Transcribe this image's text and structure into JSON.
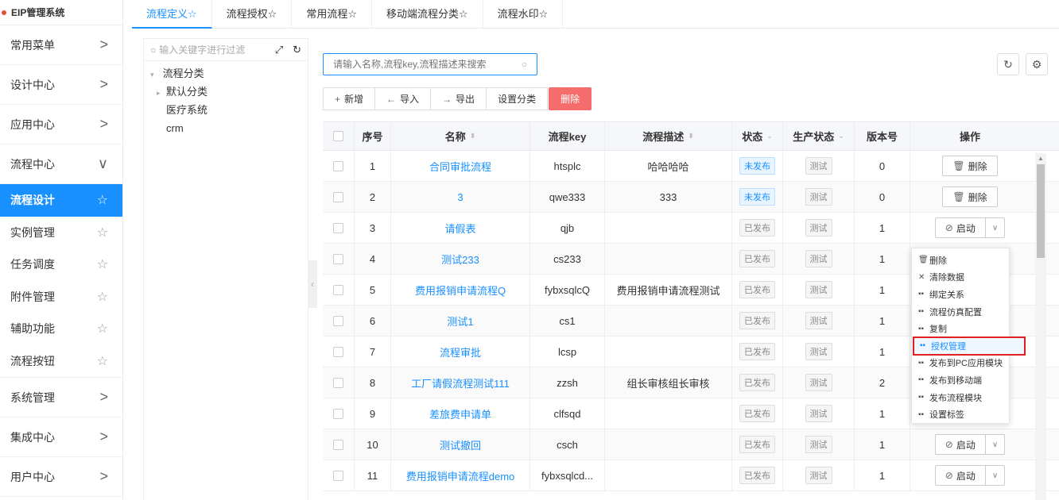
{
  "brand": "EIP管理系统",
  "sidebar": {
    "groups_top": [
      {
        "label": "常用菜单",
        "chev": ">"
      },
      {
        "label": "设计中心",
        "chev": ">"
      },
      {
        "label": "应用中心",
        "chev": ">"
      },
      {
        "label": "流程中心",
        "chev": "∨"
      }
    ],
    "sub_items": [
      {
        "label": "流程设计",
        "active": true
      },
      {
        "label": "实例管理"
      },
      {
        "label": "任务调度"
      },
      {
        "label": "附件管理"
      },
      {
        "label": "辅助功能"
      },
      {
        "label": "流程按钮"
      }
    ],
    "groups_bottom": [
      {
        "label": "系统管理",
        "chev": ">"
      },
      {
        "label": "集成中心",
        "chev": ">"
      },
      {
        "label": "用户中心",
        "chev": ">"
      }
    ]
  },
  "tabs": [
    {
      "label": "流程定义☆",
      "active": true
    },
    {
      "label": "流程授权☆"
    },
    {
      "label": "常用流程☆"
    },
    {
      "label": "移动端流程分类☆"
    },
    {
      "label": "流程水印☆"
    }
  ],
  "tree": {
    "search_placeholder": "输入关键字进行过滤",
    "root": "流程分类",
    "children": [
      {
        "label": "默认分类",
        "arrow": "▸"
      },
      {
        "label": "医疗系统"
      },
      {
        "label": "crm"
      }
    ]
  },
  "search": {
    "placeholder": "请输入名称,流程key,流程描述来搜索"
  },
  "toolbar": {
    "add": "新增",
    "import": "导入",
    "export": "导出",
    "set_category": "设置分类",
    "delete": "删除"
  },
  "table": {
    "headers": {
      "no": "序号",
      "name": "名称",
      "key": "流程key",
      "desc": "流程描述",
      "status": "状态",
      "prod": "生产状态",
      "ver": "版本号",
      "op": "操作"
    },
    "rows": [
      {
        "no": "1",
        "name": "合同审批流程",
        "key": "htsplc",
        "desc": "哈哈哈哈",
        "status": "未发布",
        "status_type": "blue",
        "prod": "测试",
        "ver": "0",
        "op": "删除",
        "op_type": "delete"
      },
      {
        "no": "2",
        "name": "3",
        "key": "qwe333",
        "desc": "333",
        "status": "未发布",
        "status_type": "blue",
        "prod": "测试",
        "ver": "0",
        "op": "删除",
        "op_type": "delete"
      },
      {
        "no": "3",
        "name": "请假表",
        "key": "qjb",
        "desc": "",
        "status": "已发布",
        "status_type": "gray",
        "prod": "测试",
        "ver": "1",
        "op": "启动",
        "op_type": "start"
      },
      {
        "no": "4",
        "name": "测试233",
        "key": "cs233",
        "desc": "",
        "status": "已发布",
        "status_type": "gray",
        "prod": "测试",
        "ver": "1",
        "op": "",
        "op_type": "none"
      },
      {
        "no": "5",
        "name": "费用报销申请流程Q",
        "key": "fybxsqlcQ",
        "desc": "费用报销申请流程测试",
        "status": "已发布",
        "status_type": "gray",
        "prod": "测试",
        "ver": "1",
        "op": "",
        "op_type": "none"
      },
      {
        "no": "6",
        "name": "测试1",
        "key": "cs1",
        "desc": "",
        "status": "已发布",
        "status_type": "gray",
        "prod": "测试",
        "ver": "1",
        "op": "",
        "op_type": "none"
      },
      {
        "no": "7",
        "name": "流程审批",
        "key": "lcsp",
        "desc": "",
        "status": "已发布",
        "status_type": "gray",
        "prod": "测试",
        "ver": "1",
        "op": "",
        "op_type": "none"
      },
      {
        "no": "8",
        "name": "工厂请假流程测试111",
        "key": "zzsh",
        "desc": "组长审核组长审核",
        "status": "已发布",
        "status_type": "gray",
        "prod": "测试",
        "ver": "2",
        "op": "",
        "op_type": "none"
      },
      {
        "no": "9",
        "name": "差旅费申请单",
        "key": "clfsqd",
        "desc": "",
        "status": "已发布",
        "status_type": "gray",
        "prod": "测试",
        "ver": "1",
        "op": "",
        "op_type": "none"
      },
      {
        "no": "10",
        "name": "测试撤回",
        "key": "csch",
        "desc": "",
        "status": "已发布",
        "status_type": "gray",
        "prod": "测试",
        "ver": "1",
        "op": "启动",
        "op_type": "start"
      },
      {
        "no": "11",
        "name": "费用报销申请流程demo",
        "key": "fybxsqlcd...",
        "desc": "",
        "status": "已发布",
        "status_type": "gray",
        "prod": "测试",
        "ver": "1",
        "op": "启动",
        "op_type": "start"
      }
    ]
  },
  "dropdown": {
    "items": [
      {
        "label": "删除",
        "icon": "trash-icon",
        "glyph": "🗑"
      },
      {
        "label": "清除数据",
        "icon": "close-icon",
        "glyph": "✕"
      },
      {
        "label": "绑定关系",
        "icon": "grid-icon",
        "glyph": "▪▪"
      },
      {
        "label": "流程仿真配置",
        "icon": "grid-icon",
        "glyph": "▪▪"
      },
      {
        "label": "复制",
        "icon": "grid-icon",
        "glyph": "▪▪"
      },
      {
        "label": "授权管理",
        "icon": "grid-icon",
        "glyph": "▪▪",
        "highlighted": true
      },
      {
        "label": "发布到PC应用模块",
        "icon": "grid-icon",
        "glyph": "▪▪"
      },
      {
        "label": "发布到移动端",
        "icon": "grid-icon",
        "glyph": "▪▪"
      },
      {
        "label": "发布流程模块",
        "icon": "grid-icon",
        "glyph": "▪▪"
      },
      {
        "label": "设置标签",
        "icon": "grid-icon",
        "glyph": "▪▪"
      }
    ]
  },
  "colors": {
    "accent": "#1890ff",
    "danger": "#f56c6c",
    "highlight_box": "#e02020"
  }
}
